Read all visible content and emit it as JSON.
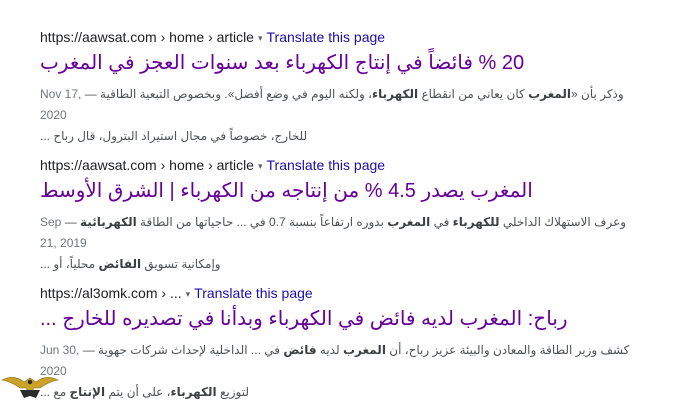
{
  "results": [
    {
      "url": "https://aawsat.com",
      "breadcrumb": " › home › article",
      "translate_label": "Translate this page",
      "title": "20 % فائضاً في إنتاج الكهرباء بعد سنوات العجز في المغرب",
      "date": "Nov 17, 2020",
      "snippet_l1_a": "وذكر بأن «",
      "snippet_l1_b": "المغرب",
      "snippet_l1_c": " كان يعاني من انقطاع ",
      "snippet_l1_d": "الكهرباء",
      "snippet_l1_e": "، ولكنه اليوم في وضع أفضل». وبخصوص التبعية الطاقية — ",
      "snippet_l2": "للخارج، خصوصاً في مجال استيراد البترول، قال رباح ..."
    },
    {
      "url": "https://aawsat.com",
      "breadcrumb": " › home › article",
      "translate_label": "Translate this page",
      "title": "المغرب يصدر 4.5 % من إنتاجه من الكهرباء | الشرق الأوسط",
      "date": "Sep 21, 2019",
      "snippet_l1_a": "وعرف الاستهلاك الداخلي ",
      "snippet_l1_b": "للكهرباء",
      "snippet_l1_c": " في ",
      "snippet_l1_d": "المغرب",
      "snippet_l1_e": " بدوره ارتفاعاً بنسبة 0.7 في ... حاجياتها من الطاقة ",
      "snippet_l1_f": "الكهربائية",
      "snippet_l1_g": " — ",
      "snippet_l2_a": "وإمكانية تسويق ",
      "snippet_l2_b": "الفائض",
      "snippet_l2_c": " محلياً، أو ..."
    },
    {
      "url": "https://al3omk.com",
      "breadcrumb": " › ...",
      "translate_label": "Translate this page",
      "title": "رباح: المغرب لديه فائض في الكهرباء وبدأنا في تصديره للخارج ...",
      "date": "Jun 30, 2020",
      "snippet_l1_a": "كشف وزير الطاقة والمعادن والبيئة عزيز رباح، أن ",
      "snippet_l1_b": "المغرب",
      "snippet_l1_c": " لديه ",
      "snippet_l1_d": "فائض",
      "snippet_l1_e": " في ... الداخلية لإحداث شركات جهوية — ",
      "snippet_l2_a": "لتوزيع ",
      "snippet_l2_b": "الكهرباء",
      "snippet_l2_c": "، على أن يتم ",
      "snippet_l2_d": "الإنتاج",
      "snippet_l2_e": " مع ..."
    }
  ],
  "icons": {
    "dropdown": "▾"
  },
  "colors": {
    "link": "#1a0dab",
    "visited": "#660099",
    "text": "#4d5156"
  }
}
